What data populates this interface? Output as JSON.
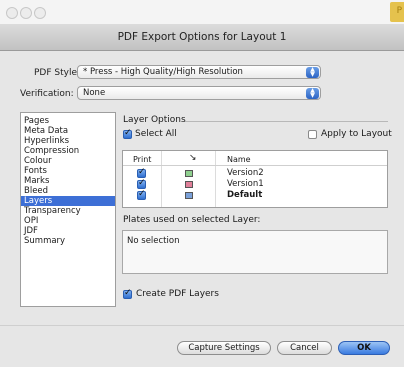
{
  "window": {
    "title": "PDF Export Options for Layout 1",
    "app_badge": "P"
  },
  "pdf_style": {
    "label": "PDF Style:",
    "value": "* Press - High Quality/High Resolution"
  },
  "verification": {
    "label": "Verification:",
    "value": "None"
  },
  "sidebar": {
    "items": [
      {
        "label": "Pages"
      },
      {
        "label": "Meta Data"
      },
      {
        "label": "Hyperlinks"
      },
      {
        "label": "Compression"
      },
      {
        "label": "Colour"
      },
      {
        "label": "Fonts"
      },
      {
        "label": "Marks"
      },
      {
        "label": "Bleed"
      },
      {
        "label": "Layers"
      },
      {
        "label": "Transparency"
      },
      {
        "label": "OPI"
      },
      {
        "label": "JDF"
      },
      {
        "label": "Summary"
      }
    ],
    "selected": "Layers"
  },
  "layer_options": {
    "title": "Layer Options",
    "select_all": {
      "label": "Select All",
      "checked": true
    },
    "apply_to_layout": {
      "label": "Apply to Layout",
      "checked": false
    },
    "columns": {
      "print": "Print",
      "name": "Name"
    },
    "rows": [
      {
        "name": "Version2",
        "print": true,
        "color": "#8fd08f"
      },
      {
        "name": "Version1",
        "print": true,
        "color": "#e07f99"
      },
      {
        "name": "Default",
        "print": true,
        "color": "#7aa0d8"
      }
    ]
  },
  "plates": {
    "label": "Plates used on selected Layer:",
    "content": "No selection"
  },
  "create_pdf_layers": {
    "label": "Create PDF Layers",
    "checked": true
  },
  "buttons": {
    "capture": "Capture Settings",
    "cancel": "Cancel",
    "ok": "OK"
  }
}
